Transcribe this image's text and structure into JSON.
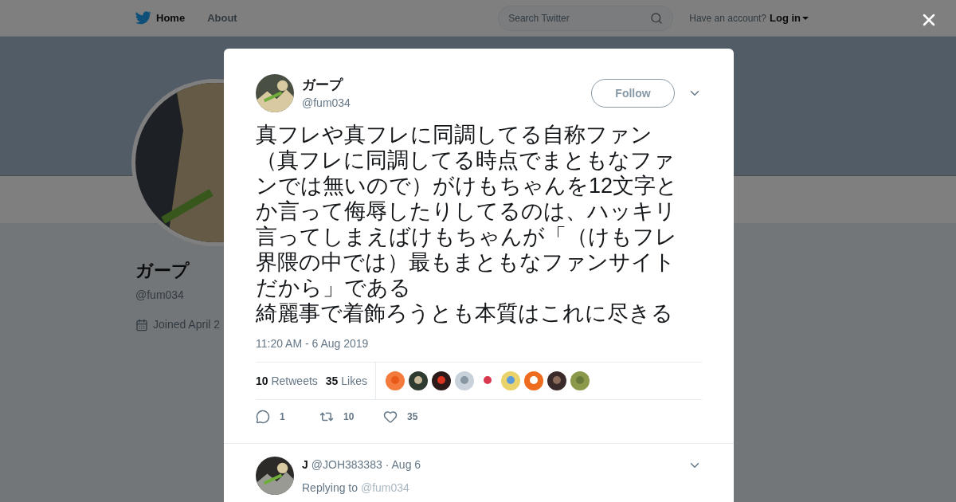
{
  "nav": {
    "links": [
      "Home",
      "About"
    ],
    "search": {
      "placeholder": "Search Twitter"
    },
    "account_prompt": "Have an account?",
    "login": "Log in"
  },
  "profile": {
    "name": "ガープ",
    "handle": "@fum034",
    "joined": "Joined April 2"
  },
  "tweet": {
    "name": "ガープ",
    "handle": "@fum034",
    "follow": "Follow",
    "paragraphs": [
      "真フレや真フレに同調してる自称ファン（真フレに同調してる時点でまともなファンでは無いので）がけもちゃんを12文字とか言って侮辱したりしてるのは、ハッキリ言ってしまえばけもちゃんが「（けもフレ界隈の中では）最もまともなファンサイトだから」である",
      "綺麗事で着飾ろうとも本質はこれに尽きる"
    ],
    "time": "11:20 AM - 6 Aug 2019",
    "stats": [
      {
        "count": "10",
        "label": "Retweets"
      },
      {
        "count": "35",
        "label": "Likes"
      }
    ],
    "actions": [
      {
        "kind": "reply",
        "count": "1"
      },
      {
        "kind": "retweet",
        "count": "10"
      },
      {
        "kind": "like",
        "count": "35"
      }
    ]
  },
  "reply": {
    "name": "J",
    "handle": "@JOH383383",
    "date": "· Aug 6",
    "replying_to": "Replying to",
    "mention": "@fum034"
  }
}
